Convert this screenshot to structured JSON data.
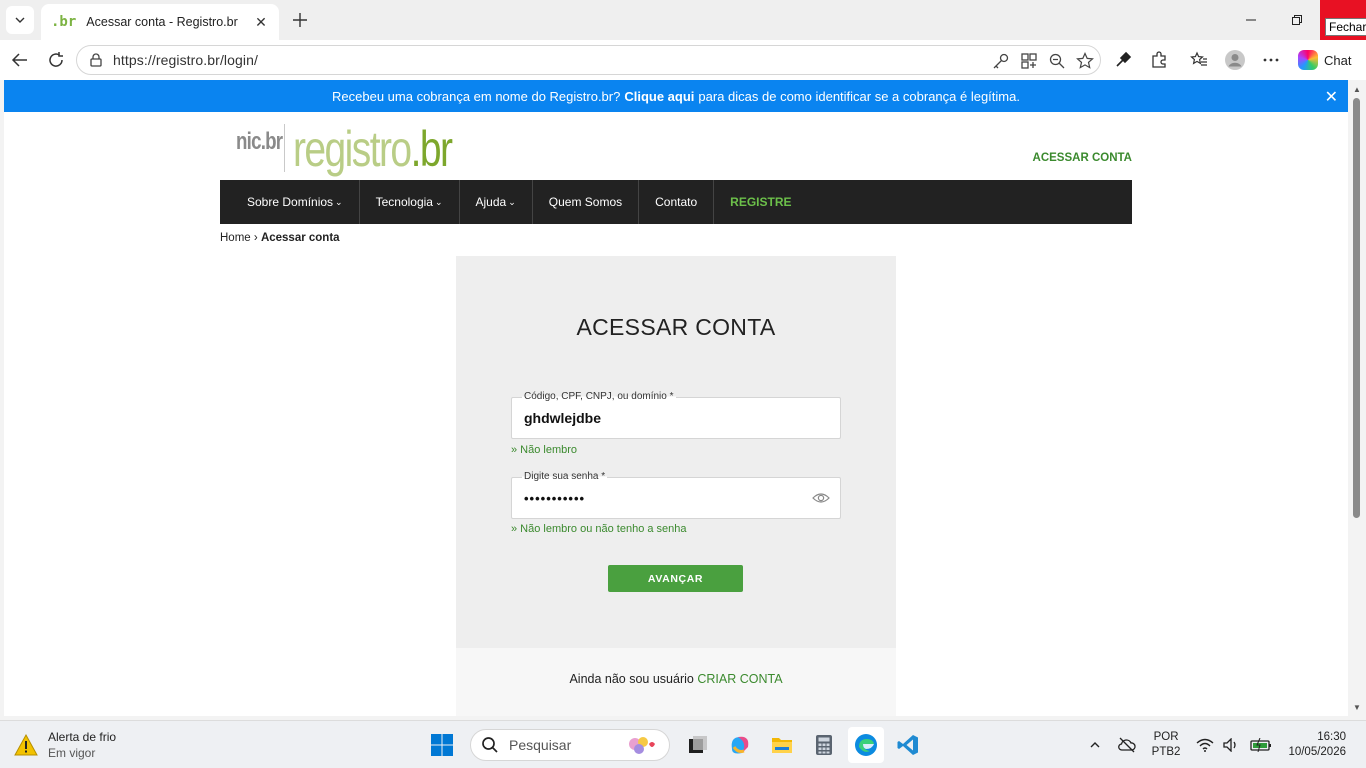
{
  "browser": {
    "tab_title": "Acessar conta - Registro.br",
    "tab_favicon": ".br",
    "url": "https://registro.br/login/",
    "tooltip": "Fechar",
    "chat_label": "Chat"
  },
  "banner": {
    "text_before": "Recebeu uma cobrança em nome do Registro.br?",
    "link": "Clique aqui",
    "text_after": "para dicas de como identificar se a cobrança é legítima."
  },
  "header": {
    "logo_nic": "nic.br",
    "logo_main": "registro",
    "logo_tld": ".br",
    "account_link": "ACESSAR CONTA"
  },
  "nav": {
    "items": [
      {
        "label": "Sobre Domínios",
        "dropdown": true
      },
      {
        "label": "Tecnologia",
        "dropdown": true
      },
      {
        "label": "Ajuda",
        "dropdown": true
      },
      {
        "label": "Quem Somos",
        "dropdown": false
      },
      {
        "label": "Contato",
        "dropdown": false
      },
      {
        "label": "REGISTRE",
        "dropdown": false
      }
    ],
    "chevron": "⌄"
  },
  "breadcrumb": {
    "home": "Home",
    "separator": "›",
    "current": "Acessar conta"
  },
  "login": {
    "title": "ACESSAR CONTA",
    "user_label": "Código, CPF, CNPJ, ou domínio *",
    "user_value": "ghdwlejdbe",
    "user_help": "» Não lembro",
    "password_label": "Digite sua senha *",
    "password_value": "•••••••••••",
    "password_help": "» Não lembro ou não tenho a senha",
    "submit": "AVANÇAR",
    "signup_text": "Ainda não sou usuário",
    "signup_link": "CRIAR CONTA"
  },
  "taskbar": {
    "weather_title": "Alerta de frio",
    "weather_sub": "Em vigor",
    "search_placeholder": "Pesquisar",
    "lang_line1": "POR",
    "lang_line2": "PTB2",
    "time": "16:30",
    "date": "10/05/2026"
  },
  "colors": {
    "banner": "#0a84f0",
    "brand_green": "#3b8a2e",
    "button_green": "#4aa03f",
    "nav_bg": "#222222"
  }
}
